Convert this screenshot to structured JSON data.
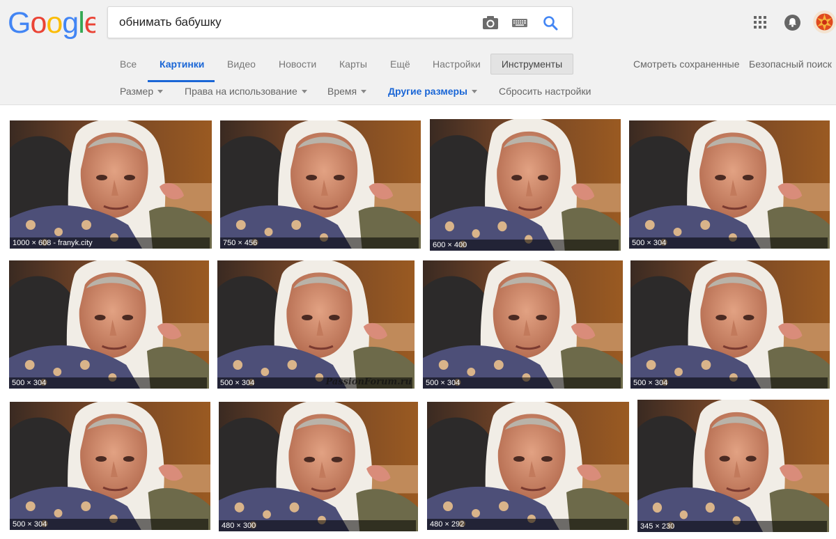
{
  "search": {
    "query": "обнимать бабушку"
  },
  "nav": {
    "tabs": [
      "Все",
      "Картинки",
      "Видео",
      "Новости",
      "Карты",
      "Ещё",
      "Настройки"
    ],
    "active_tab": "Картинки",
    "tools_label": "Инструменты",
    "saved_label": "Смотреть сохраненные",
    "safe_search_label": "Безопасный поиск"
  },
  "tools": {
    "size": "Размер",
    "rights": "Права на использование",
    "time": "Время",
    "other_sizes": "Другие размеры",
    "reset": "Сбросить настройки"
  },
  "results": [
    {
      "dims": "1000 × 608 - franyk.city"
    },
    {
      "dims": "750 × 456"
    },
    {
      "dims": "600 × 400"
    },
    {
      "dims": "500 × 304"
    },
    {
      "dims": "500 × 304"
    },
    {
      "dims": "500 × 304",
      "watermark": "PassionForum.ru"
    },
    {
      "dims": "500 × 304"
    },
    {
      "dims": "500 × 304"
    },
    {
      "dims": "500 × 304"
    },
    {
      "dims": "480 × 300"
    },
    {
      "dims": "480 × 292"
    },
    {
      "dims": "345 × 230"
    }
  ],
  "icons": {
    "camera": "camera-icon",
    "keyboard": "keyboard-icon",
    "search": "search-icon",
    "apps": "apps-grid-icon",
    "notifications": "bell-icon"
  },
  "colors": {
    "accent_blue": "#1a66d6",
    "header_bg": "#f1f1f1"
  }
}
